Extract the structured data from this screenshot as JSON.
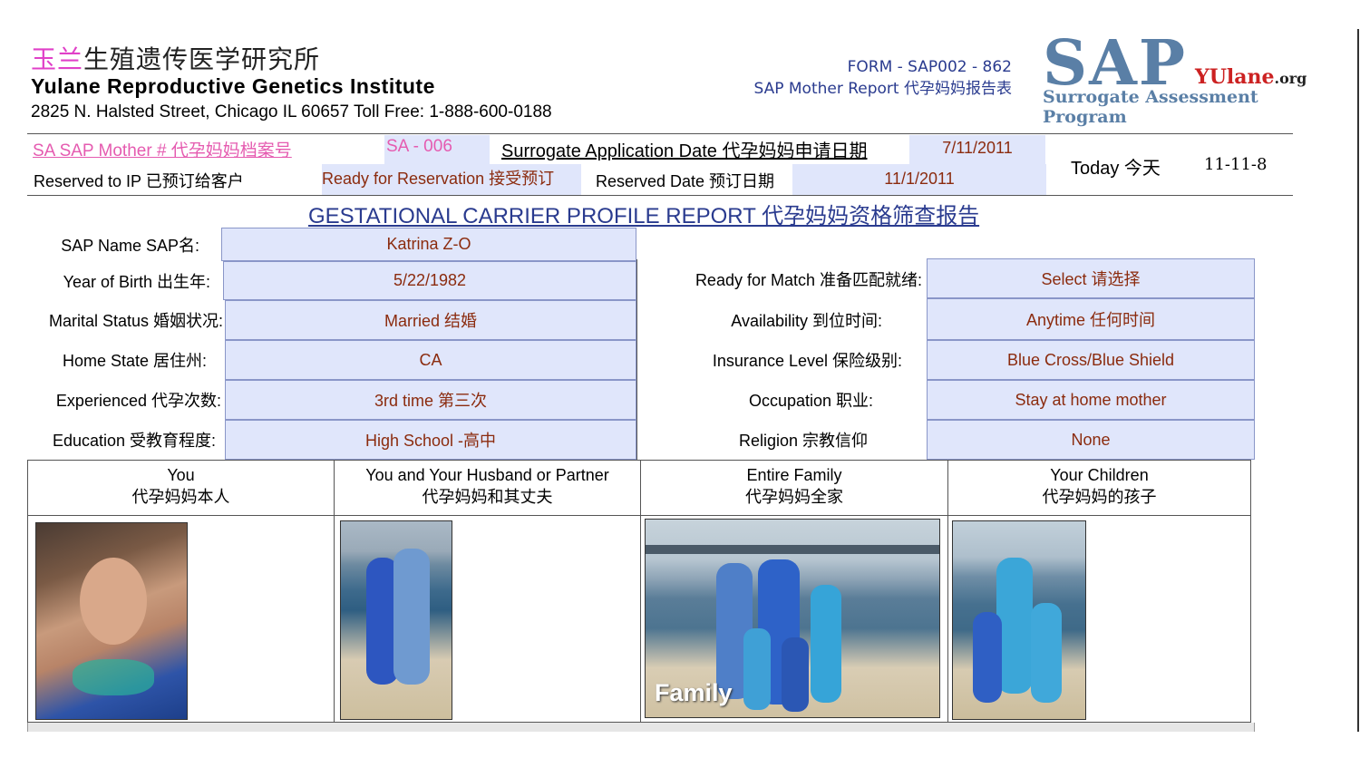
{
  "header": {
    "cn_prefix": "玉兰",
    "cn_rest": "生殖遗传医学研究所",
    "en_name": "Yulane Reproductive Genetics Institute",
    "address": "2825 N. Halsted Street, Chicago IL 60657  Toll Free: 1-888-600-0188",
    "form_number": "FORM - SAP002 - 862",
    "form_title": "SAP Mother Report 代孕妈妈报告表"
  },
  "logo": {
    "big": "SAP",
    "brand": "YUlane",
    "brand_suffix": ".org",
    "program": "Surrogate Assessment Program",
    "colors": {
      "blue": "#5a7fa6",
      "red": "#cc2222"
    }
  },
  "info_bar": {
    "sa_label": "SA SAP Mother  # 代孕妈妈档案号",
    "sa_value": "SA - 006",
    "app_date_label": "Surrogate Application Date 代孕妈妈申请日期",
    "app_date_value": "7/11/2011",
    "reserved_label": "Reserved to IP  已预订给客户",
    "reservation_status": "Ready for Reservation 接受预订",
    "reserved_date_label": "Reserved Date 预订日期",
    "reserved_date_value": "11/1/2011",
    "today_label": "Today 今天",
    "today_value": "11-11-8"
  },
  "report_title": "GESTATIONAL CARRIER PROFILE REPORT 代孕妈妈资格筛查报告",
  "fields_left": [
    {
      "label": "SAP Name SAP名:",
      "value": "Katrina Z-O"
    },
    {
      "label": "Year of Birth 出生年:",
      "value": "5/22/1982"
    },
    {
      "label": "Marital Status 婚姻状况:",
      "value": "Married 结婚"
    },
    {
      "label": "Home State 居住州:",
      "value": "CA"
    },
    {
      "label": "Experienced  代孕次数:",
      "value": "3rd time 第三次"
    },
    {
      "label": "Education 受教育程度:",
      "value": "High School -高中"
    }
  ],
  "fields_right": [
    {
      "label": "Ready for Match 准备匹配就绪:",
      "value": "Select 请选择"
    },
    {
      "label": "Availability 到位时间:",
      "value": "Anytime 任何时间"
    },
    {
      "label": "Insurance Level 保险级别:",
      "value": "Blue Cross/Blue Shield"
    },
    {
      "label": "Occupation  职业:",
      "value": "Stay at home mother"
    },
    {
      "label": "Religion 宗教信仰",
      "value": "None"
    }
  ],
  "photo_columns": [
    {
      "en": "You",
      "cn": "代孕妈妈本人"
    },
    {
      "en": "You and Your Husband or Partner",
      "cn": "代孕妈妈和其丈夫"
    },
    {
      "en": "Entire Family",
      "cn": "代孕妈妈全家"
    },
    {
      "en": "Your Children",
      "cn": "代孕妈妈的孩子"
    }
  ],
  "family_photo_caption": "Family"
}
